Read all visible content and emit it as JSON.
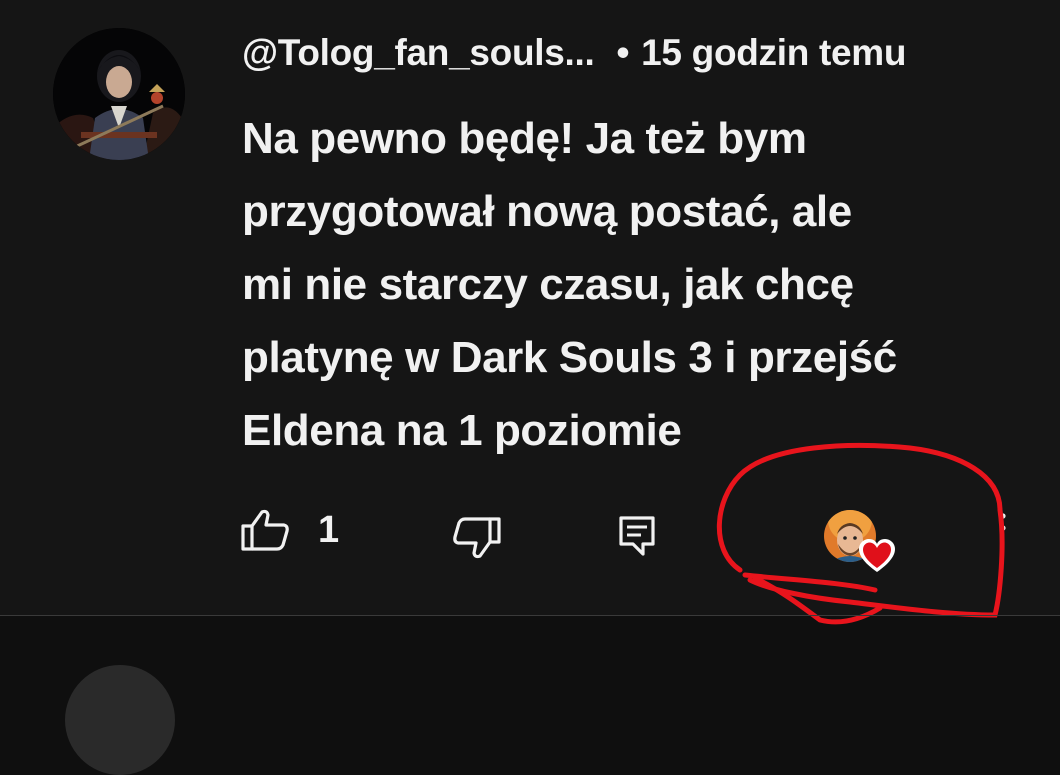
{
  "comment": {
    "author": "@Tolog_fan_souls...",
    "separator": "•",
    "timestamp": "15 godzin temu",
    "text": "Na pewno będę! Ja też bym\nprzygotował nową postać, ale\nmi nie starczy czasu, jak chcę\nplatynę w Dark Souls 3 i przejść\nEldena na 1 poziomie",
    "like_count": "1",
    "avatar_icon": "user-avatar-dark-fantasy-character",
    "creator_heart_icon": "creator-heart-badge"
  },
  "actions": {
    "like_icon": "thumbs-up-icon",
    "dislike_icon": "thumbs-down-icon",
    "reply_icon": "reply-icon"
  },
  "colors": {
    "background": "#0f0f0f",
    "comment_bg": "#151515",
    "text": "#f1f1f1",
    "heart": "#e0101a",
    "annotation": "#e8141c"
  }
}
